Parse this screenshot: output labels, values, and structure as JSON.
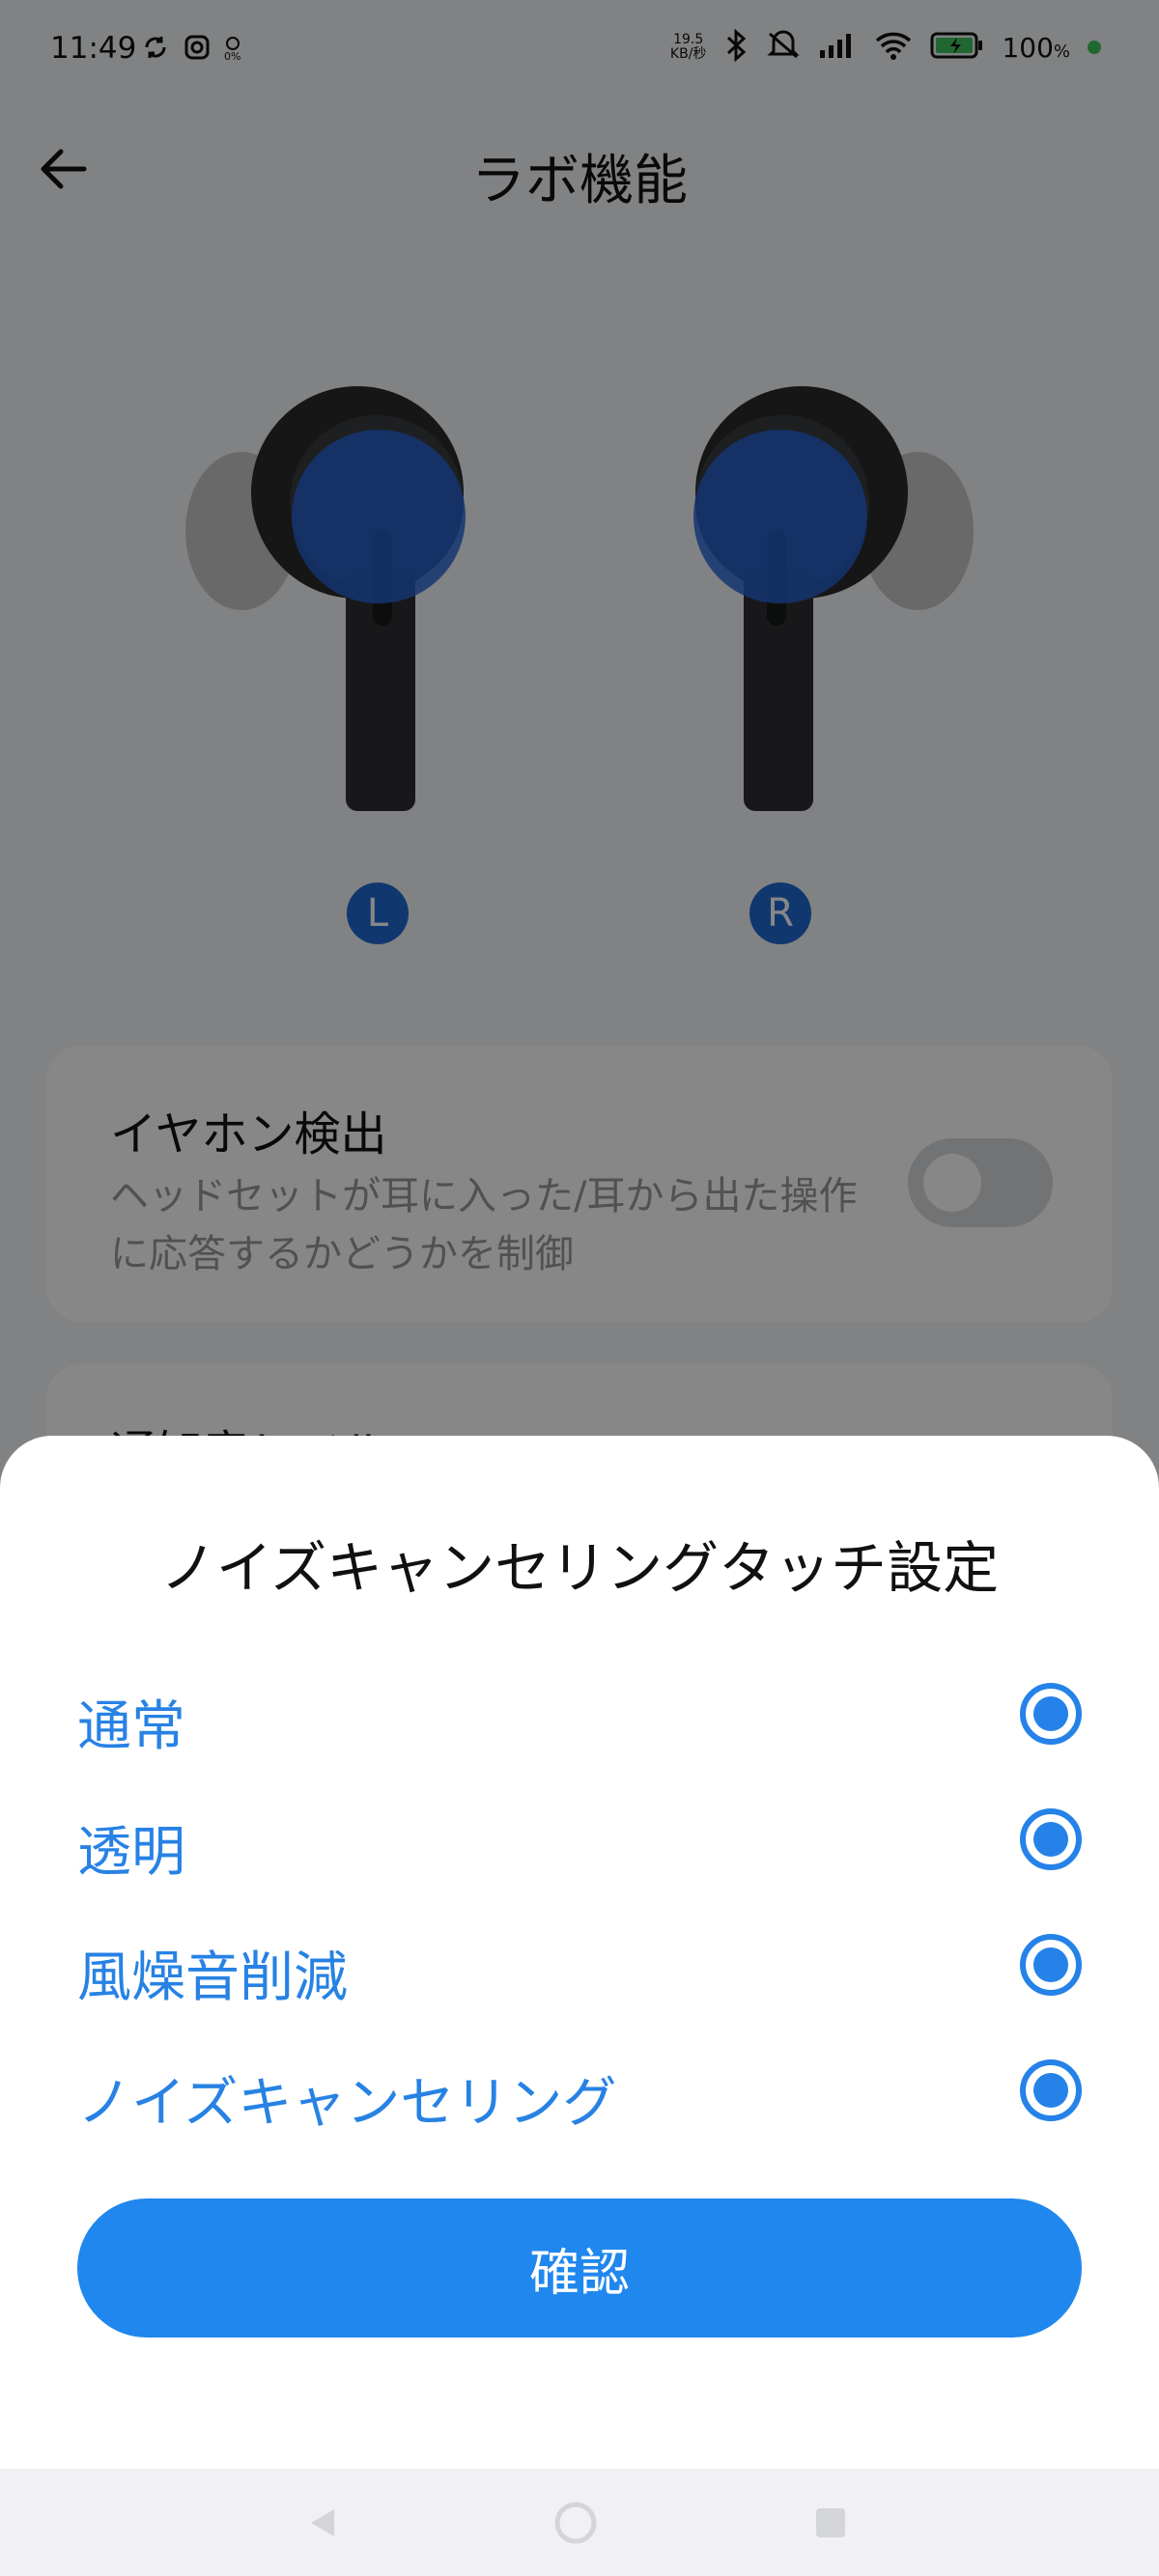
{
  "status_bar": {
    "time": "11:49",
    "netspeed_value": "19.5",
    "netspeed_unit": "KB/秒",
    "battery_percent": "100",
    "battery_suffix": "%",
    "dot_label": "0%"
  },
  "header": {
    "title": "ラボ機能"
  },
  "earbuds": {
    "left_label": "L",
    "right_label": "R"
  },
  "cards": {
    "earphone_detection": {
      "title": "イヤホン検出",
      "description": "ヘッドセットが耳に入った/耳から出た操作に応答するかどうかを制御",
      "enabled": false
    },
    "notification_level": {
      "title": "通知音レベル"
    }
  },
  "sheet": {
    "title": "ノイズキャンセリングタッチ設定",
    "options": [
      {
        "label": "通常",
        "selected": true
      },
      {
        "label": "透明",
        "selected": true
      },
      {
        "label": "風燥音削減",
        "selected": true
      },
      {
        "label": "ノイズキャンセリング",
        "selected": true
      }
    ],
    "confirm_label": "確認"
  },
  "colors": {
    "accent": "#1f87ee",
    "option_text": "#2782e4",
    "scrim": "rgba(0,0,0,0.47)"
  },
  "icons": {
    "back": "arrow-left-icon",
    "sync": "sync-icon",
    "instagram": "instagram-icon",
    "bluetooth": "bluetooth-icon",
    "mute": "mute-icon",
    "signal": "signal-icon",
    "wifi": "wifi-icon",
    "battery": "battery-charging-icon",
    "nav_back": "nav-back-icon",
    "nav_home": "nav-home-icon",
    "nav_recents": "nav-recents-icon"
  }
}
